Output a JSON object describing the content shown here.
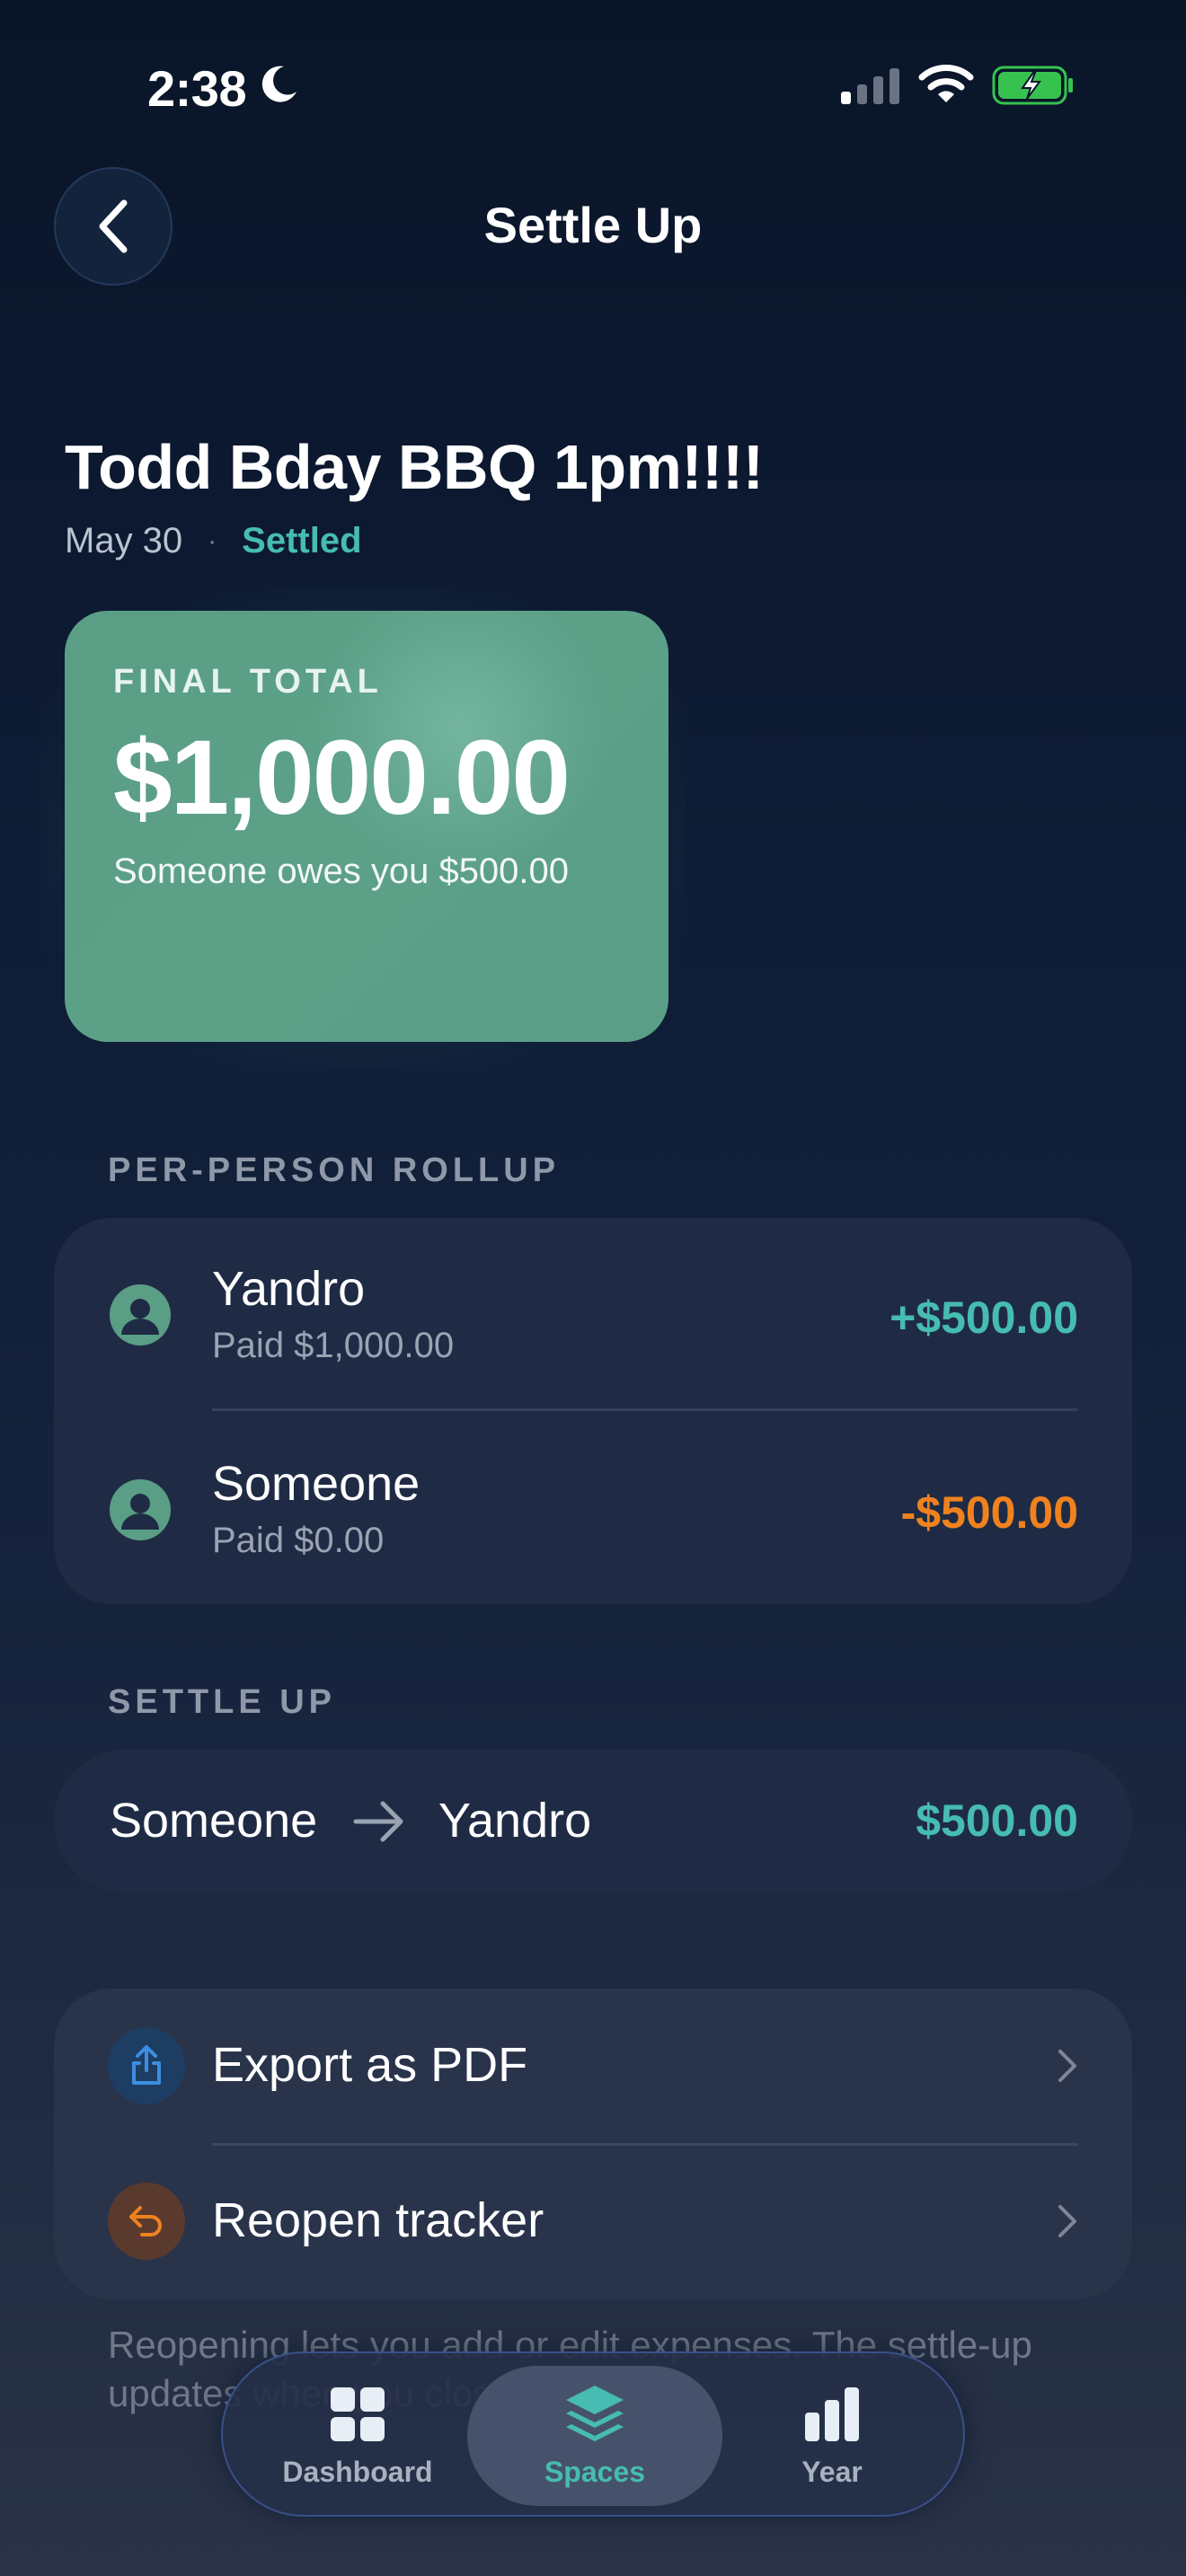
{
  "status_bar": {
    "time": "2:38"
  },
  "header": {
    "title": "Settle Up"
  },
  "tracker": {
    "title": "Todd Bday BBQ 1pm!!!!",
    "date": "May 30",
    "separator": "·",
    "status": "Settled"
  },
  "total_card": {
    "label": "FINAL TOTAL",
    "amount": "$1,000.00",
    "subtitle": "Someone owes you $500.00"
  },
  "rollup": {
    "label": "PER-PERSON ROLLUP",
    "people": [
      {
        "name": "Yandro",
        "paid": "Paid $1,000.00",
        "balance": "+$500.00",
        "color": "#46bcb2"
      },
      {
        "name": "Someone",
        "paid": "Paid $0.00",
        "balance": "-$500.00",
        "color": "#f0821e"
      }
    ]
  },
  "settle": {
    "label": "SETTLE UP",
    "from": "Someone",
    "to": "Yandro",
    "amount": "$500.00"
  },
  "actions": [
    {
      "label": "Export as PDF",
      "icon": "share-icon"
    },
    {
      "label": "Reopen tracker",
      "icon": "undo-arrow-icon"
    }
  ],
  "footnote": "Reopening lets you add or edit expenses. The settle-up updates when you close it again.",
  "tabs": [
    {
      "label": "Dashboard",
      "icon": "grid-icon",
      "active": false
    },
    {
      "label": "Spaces",
      "icon": "layers-icon",
      "active": true
    },
    {
      "label": "Year",
      "icon": "bar-chart-icon",
      "active": false
    }
  ],
  "colors": {
    "accent": "#46bcb2",
    "negative": "#f0821e",
    "card": "#5a9e85"
  }
}
